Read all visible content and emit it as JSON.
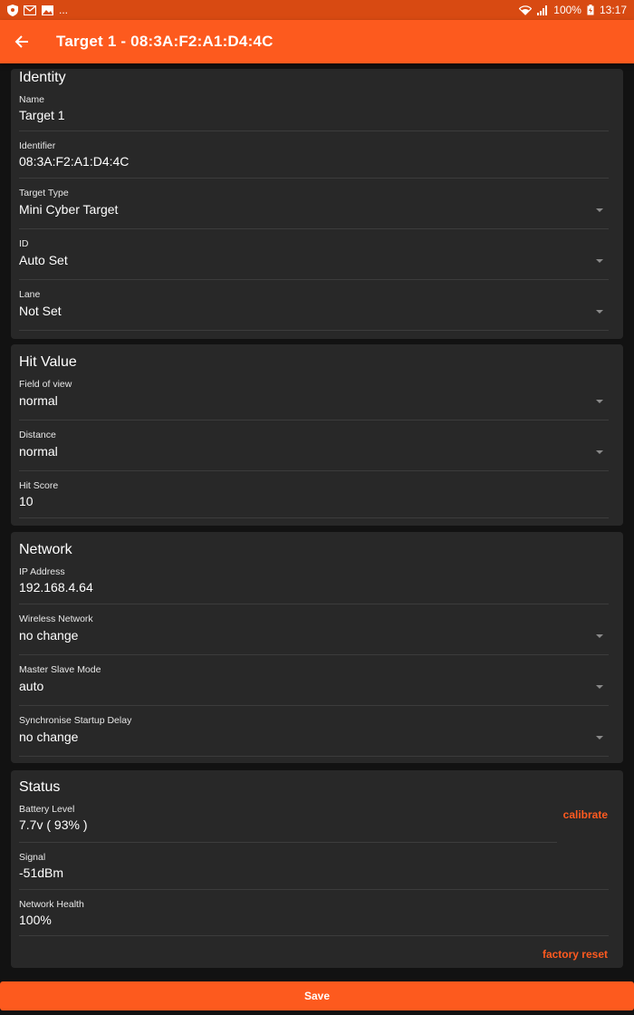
{
  "status_bar": {
    "left_icons": [
      "shield-icon",
      "gmail-icon",
      "gallery-icon"
    ],
    "more": "...",
    "battery": "100%",
    "time": "13:17"
  },
  "app_bar": {
    "title": "Target 1 - 08:3A:F2:A1:D4:4C"
  },
  "identity": {
    "title": "Identity",
    "name_label": "Name",
    "name_value": "Target 1",
    "identifier_label": "Identifier",
    "identifier_value": "08:3A:F2:A1:D4:4C",
    "target_type_label": "Target Type",
    "target_type_value": "Mini Cyber Target",
    "id_label": "ID",
    "id_value": "Auto Set",
    "lane_label": "Lane",
    "lane_value": "Not Set"
  },
  "hit_value": {
    "title": "Hit Value",
    "fov_label": "Field of view",
    "fov_value": "normal",
    "distance_label": "Distance",
    "distance_value": "normal",
    "hit_score_label": "Hit Score",
    "hit_score_value": "10"
  },
  "network": {
    "title": "Network",
    "ip_label": "IP Address",
    "ip_value": "192.168.4.64",
    "wifi_label": "Wireless Network",
    "wifi_value": "no change",
    "ms_label": "Master Slave Mode",
    "ms_value": "auto",
    "sync_label": "Synchronise Startup Delay",
    "sync_value": "no change"
  },
  "status": {
    "title": "Status",
    "battery_label": "Battery Level",
    "battery_value": "7.7v ( 93% )",
    "calibrate_label": "calibrate",
    "signal_label": "Signal",
    "signal_value": "-51dBm",
    "health_label": "Network Health",
    "health_value": "100%",
    "factory_reset_label": "factory reset"
  },
  "save_label": "Save",
  "colors": {
    "accent": "#fd5a1e",
    "status_bar": "#d84a12",
    "card": "#282828",
    "background": "#121212"
  }
}
